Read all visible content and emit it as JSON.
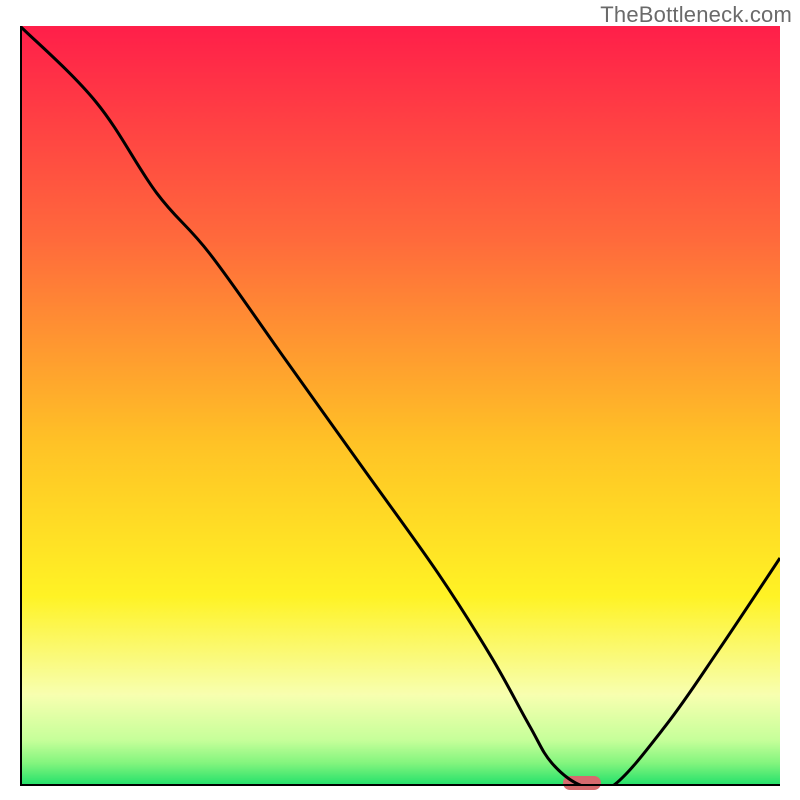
{
  "watermark": "TheBottleneck.com",
  "chart_data": {
    "type": "line",
    "title": "",
    "xlabel": "",
    "ylabel": "",
    "xlim": [
      0,
      100
    ],
    "ylim": [
      0,
      100
    ],
    "x": [
      0,
      10,
      18,
      25,
      35,
      45,
      55,
      62,
      67,
      70,
      74,
      78,
      85,
      92,
      100
    ],
    "values": [
      100,
      90,
      78,
      70,
      56,
      42,
      28,
      17,
      8,
      3,
      0,
      0,
      8,
      18,
      30
    ],
    "marker": {
      "x": 74,
      "y": 0,
      "shape": "pill",
      "color": "#d76a6e"
    },
    "background_gradient": {
      "stops": [
        {
          "pos": 0.0,
          "color": "#ff1f4a"
        },
        {
          "pos": 0.28,
          "color": "#ff6a3c"
        },
        {
          "pos": 0.55,
          "color": "#ffc326"
        },
        {
          "pos": 0.75,
          "color": "#fff325"
        },
        {
          "pos": 0.88,
          "color": "#f8ffb0"
        },
        {
          "pos": 0.94,
          "color": "#c6ff9a"
        },
        {
          "pos": 0.97,
          "color": "#83f57e"
        },
        {
          "pos": 1.0,
          "color": "#1fe06a"
        }
      ]
    },
    "curve_color": "#000000",
    "curve_width": 3
  }
}
